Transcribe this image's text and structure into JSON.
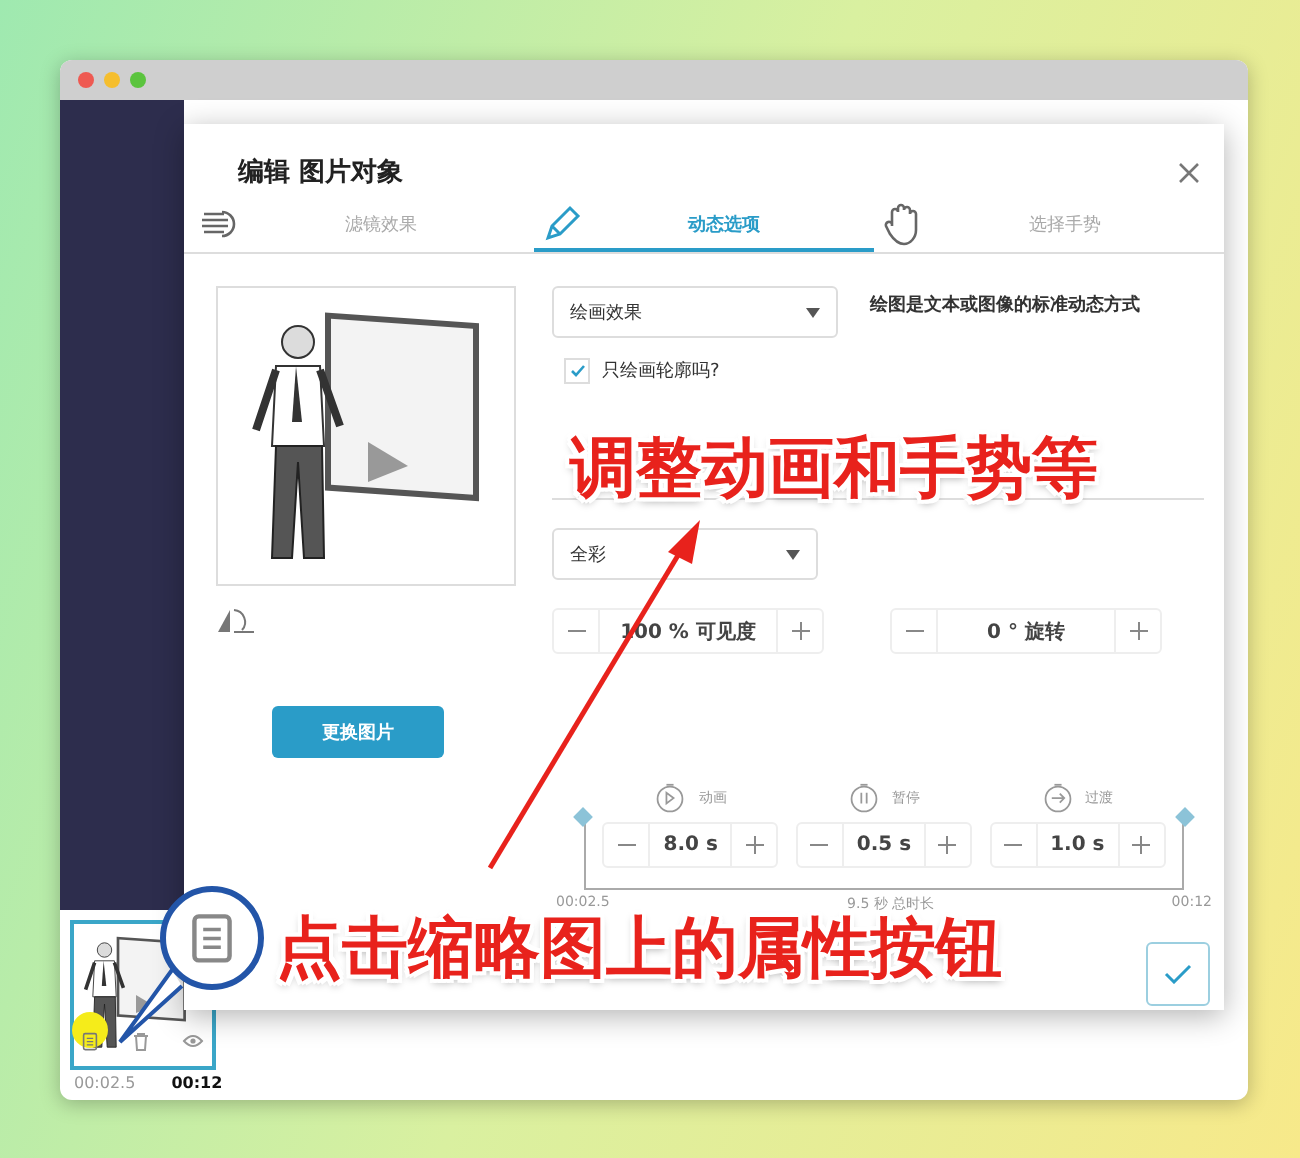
{
  "window": {
    "dots": [
      {
        "color": "#ee5a52"
      },
      {
        "color": "#f5be2e"
      },
      {
        "color": "#5bc43e"
      }
    ]
  },
  "dialog": {
    "title": "编辑 图片对象",
    "tabs": [
      {
        "kind": "filter",
        "label": "滤镜效果",
        "selected": false
      },
      {
        "kind": "pencil",
        "label": "动态选项",
        "selected": true
      },
      {
        "kind": "hand",
        "label": "选择手势",
        "selected": false
      }
    ],
    "effect_select": {
      "value": "绘画效果"
    },
    "description": "绘图是文本或图像的标准动态方式",
    "outline_only": {
      "label": "只绘画轮廓吗?",
      "checked": true
    },
    "color_select": {
      "value": "全彩"
    },
    "opacity": {
      "value": "100 % 可见度"
    },
    "rotation": {
      "value": "0 ° 旋转"
    },
    "change_image_button": "更换图片",
    "timeline": {
      "segments": [
        {
          "kind": "play",
          "label": "动画",
          "value": "8.0 s"
        },
        {
          "kind": "pause",
          "label": "暂停",
          "value": "0.5 s"
        },
        {
          "kind": "transition",
          "label": "过渡",
          "value": "1.0 s"
        }
      ],
      "start": "00:02.5",
      "total": "9.5 秒 总时长",
      "end": "00:12"
    }
  },
  "thumbnail": {
    "start": "00:02.5",
    "end": "00:12"
  },
  "annotations": [
    {
      "text": "调整动画和手势等"
    },
    {
      "text": "点击缩略图上的属性按钮"
    }
  ]
}
